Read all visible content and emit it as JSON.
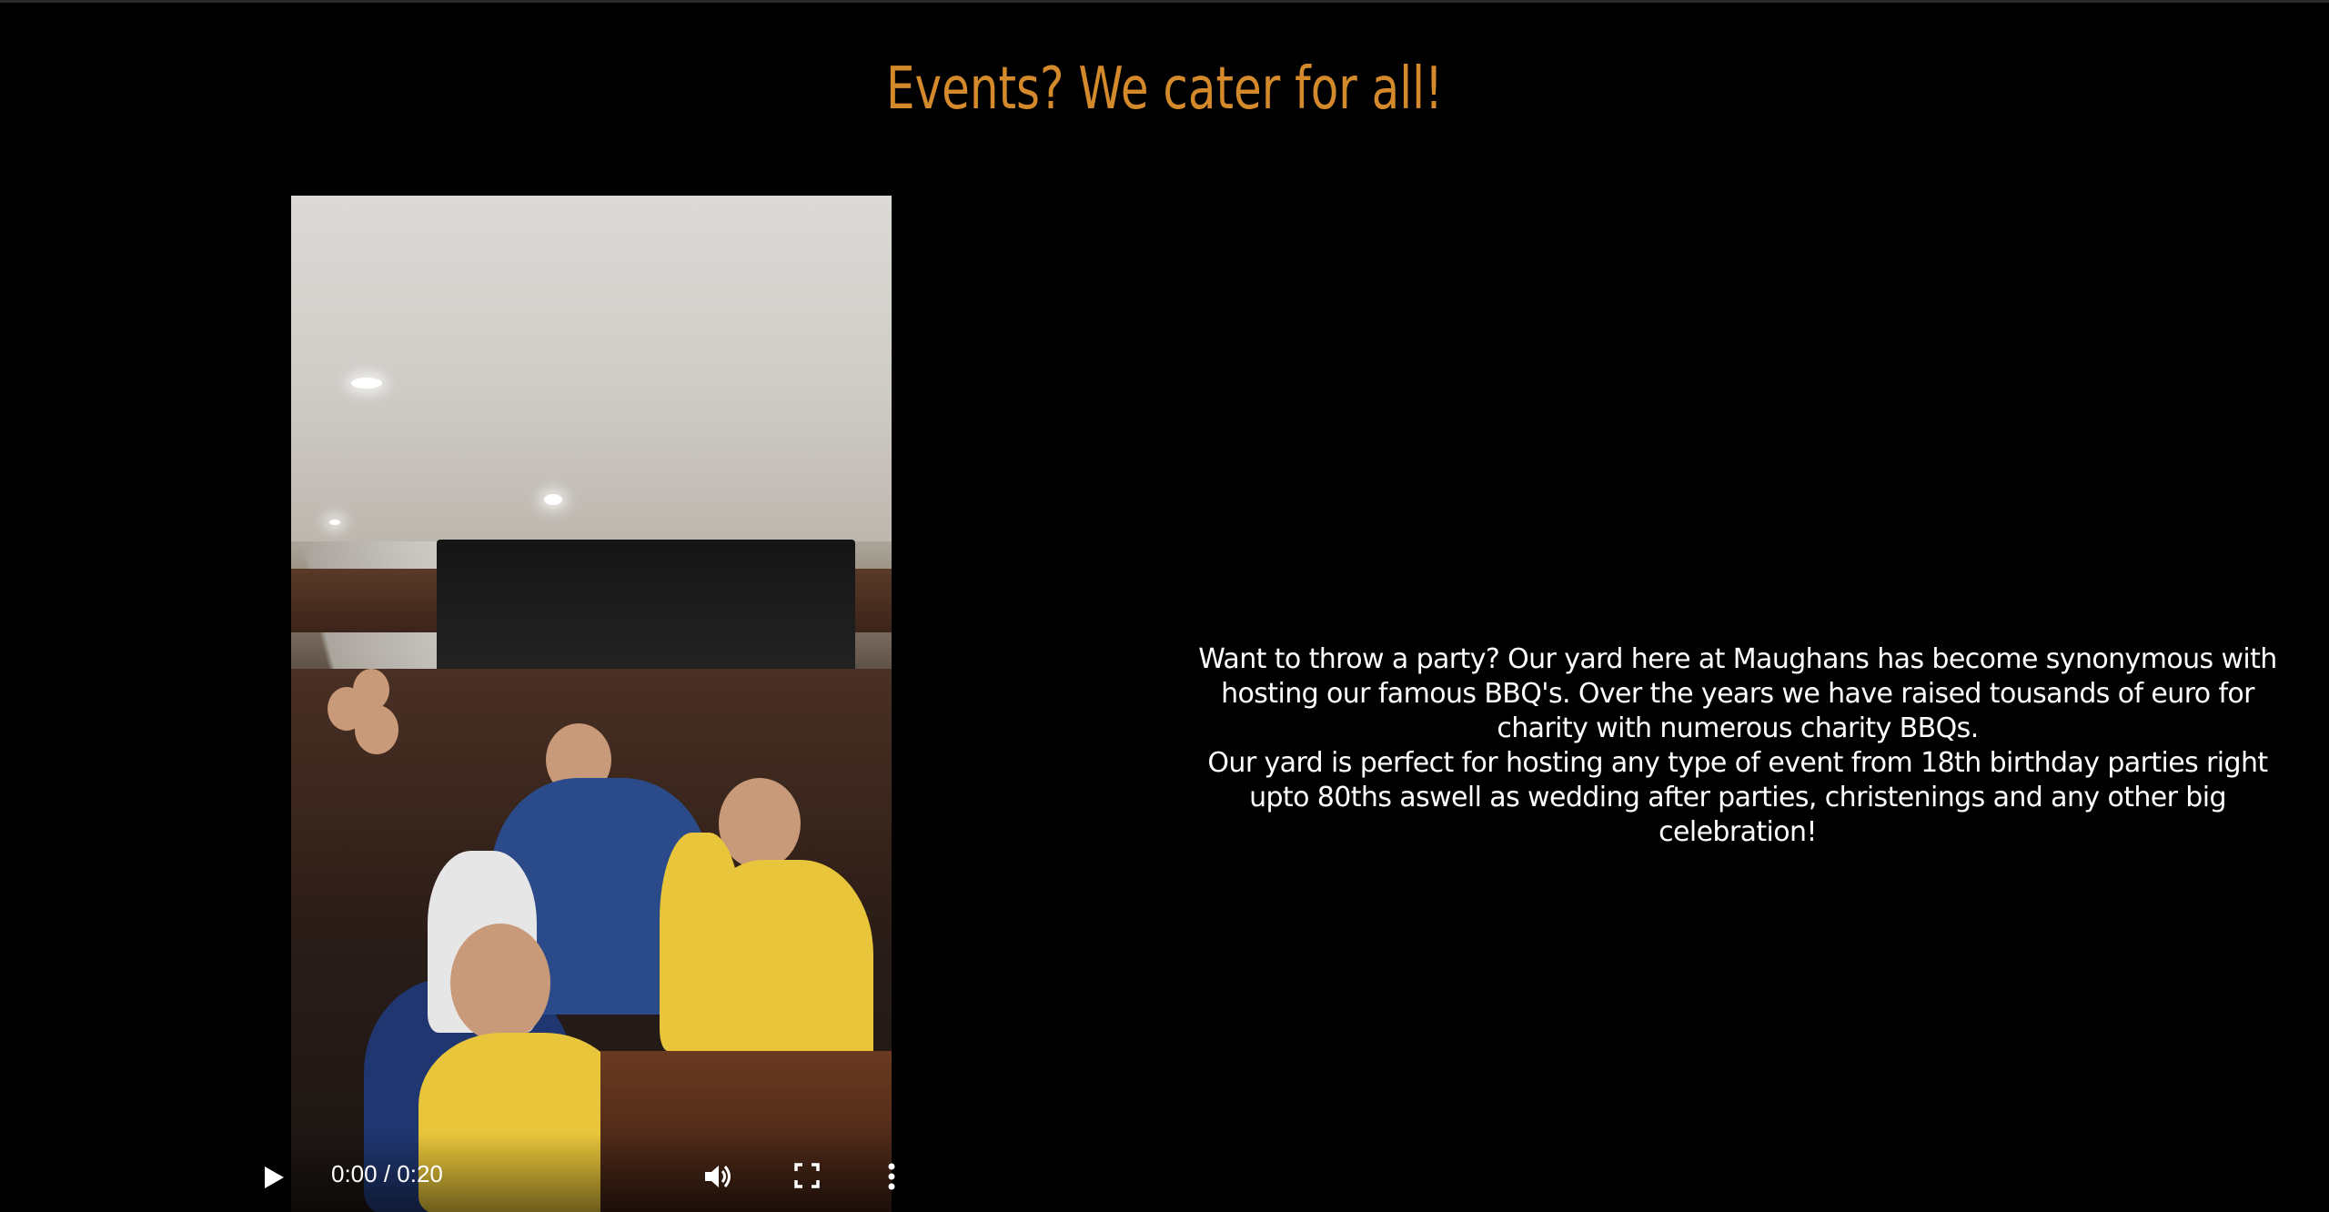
{
  "section": {
    "title": "Events? We cater for all!",
    "description_lines": [
      "Want to throw a party? Our yard here at Maughans has become synonymous with hosting our famous BBQ's. Over the years we have raised tousands of euro for charity with numerous charity BBQs.",
      "Our yard is perfect for hosting any type of event from 18th birthday parties right upto 80ths aswell as wedding after parties, christenings and any other big celebration!"
    ]
  },
  "video": {
    "time_display": "0:00 / 0:20",
    "controls": {
      "play_icon": "play-icon",
      "volume_icon": "volume-icon",
      "fullscreen_icon": "fullscreen-icon",
      "more_icon": "more-options-icon"
    }
  },
  "colors": {
    "background": "#000000",
    "title": "#d4892a",
    "text": "#ffffff"
  }
}
